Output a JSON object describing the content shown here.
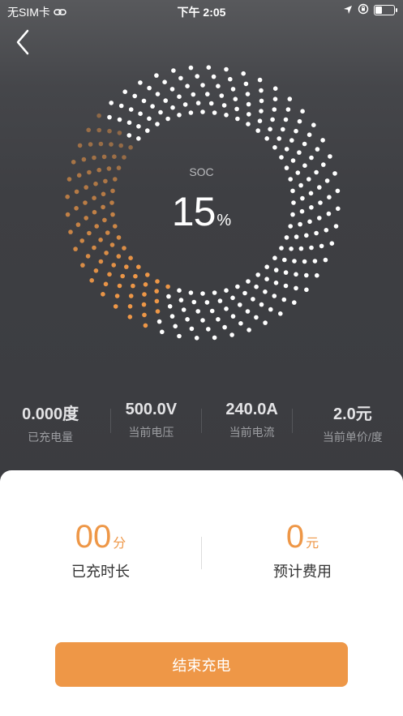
{
  "status_bar": {
    "carrier": "无SIM卡",
    "time": "下午 2:05"
  },
  "soc": {
    "label": "SOC",
    "value": "15",
    "unit": "%",
    "fraction": 0.15
  },
  "stats": [
    {
      "value": "0.000度",
      "label": "已充电量"
    },
    {
      "value": "500.0V",
      "label": "当前电压"
    },
    {
      "value": "240.0A",
      "label": "当前电流"
    },
    {
      "value": "2.0元",
      "label": "当前单价/度"
    }
  ],
  "summary": {
    "duration_value": "00",
    "duration_unit": "分",
    "duration_label": "已充时长",
    "cost_value": "0",
    "cost_unit": "元",
    "cost_label": "预计费用"
  },
  "end_button_label": "结束充电",
  "colors": {
    "accent": "#ee9747",
    "background": "#3b3c40",
    "dot_inactive": "#ffffff"
  },
  "icons": [
    "link-icon",
    "location-arrow-icon",
    "orientation-lock-icon",
    "battery-icon",
    "back-chevron-icon"
  ]
}
